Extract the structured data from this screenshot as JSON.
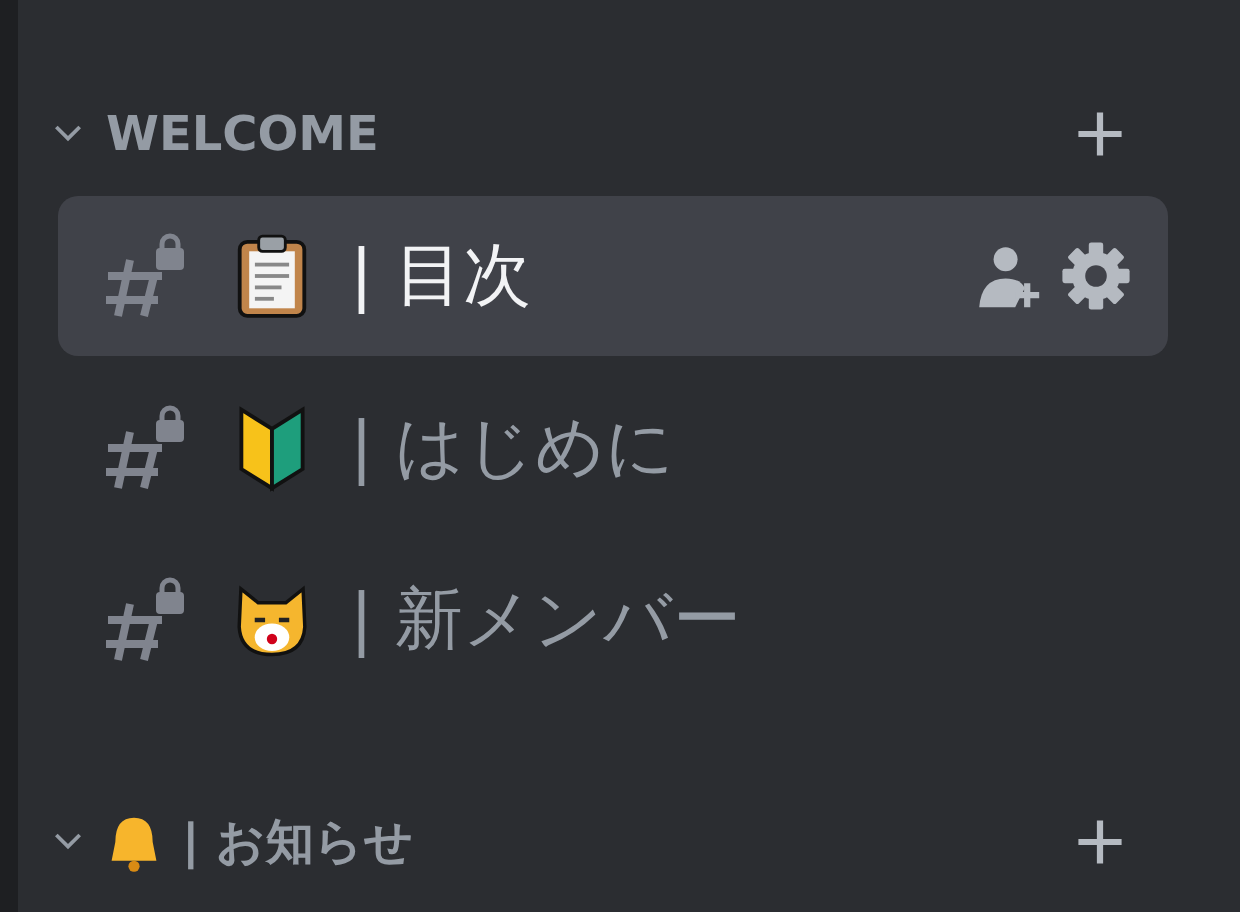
{
  "categories": [
    {
      "name": "WELCOME",
      "kind": "plain",
      "expanded": true,
      "channels": [
        {
          "kind": "clipboard",
          "name": "| 目次",
          "locked": true,
          "selected": true
        },
        {
          "kind": "beginner",
          "name": "| はじめに",
          "locked": true,
          "selected": false
        },
        {
          "kind": "cat",
          "name": "| 新メンバー",
          "locked": true,
          "selected": false
        }
      ]
    },
    {
      "name": "| お知らせ",
      "kind": "bell",
      "expanded": true
    }
  ]
}
